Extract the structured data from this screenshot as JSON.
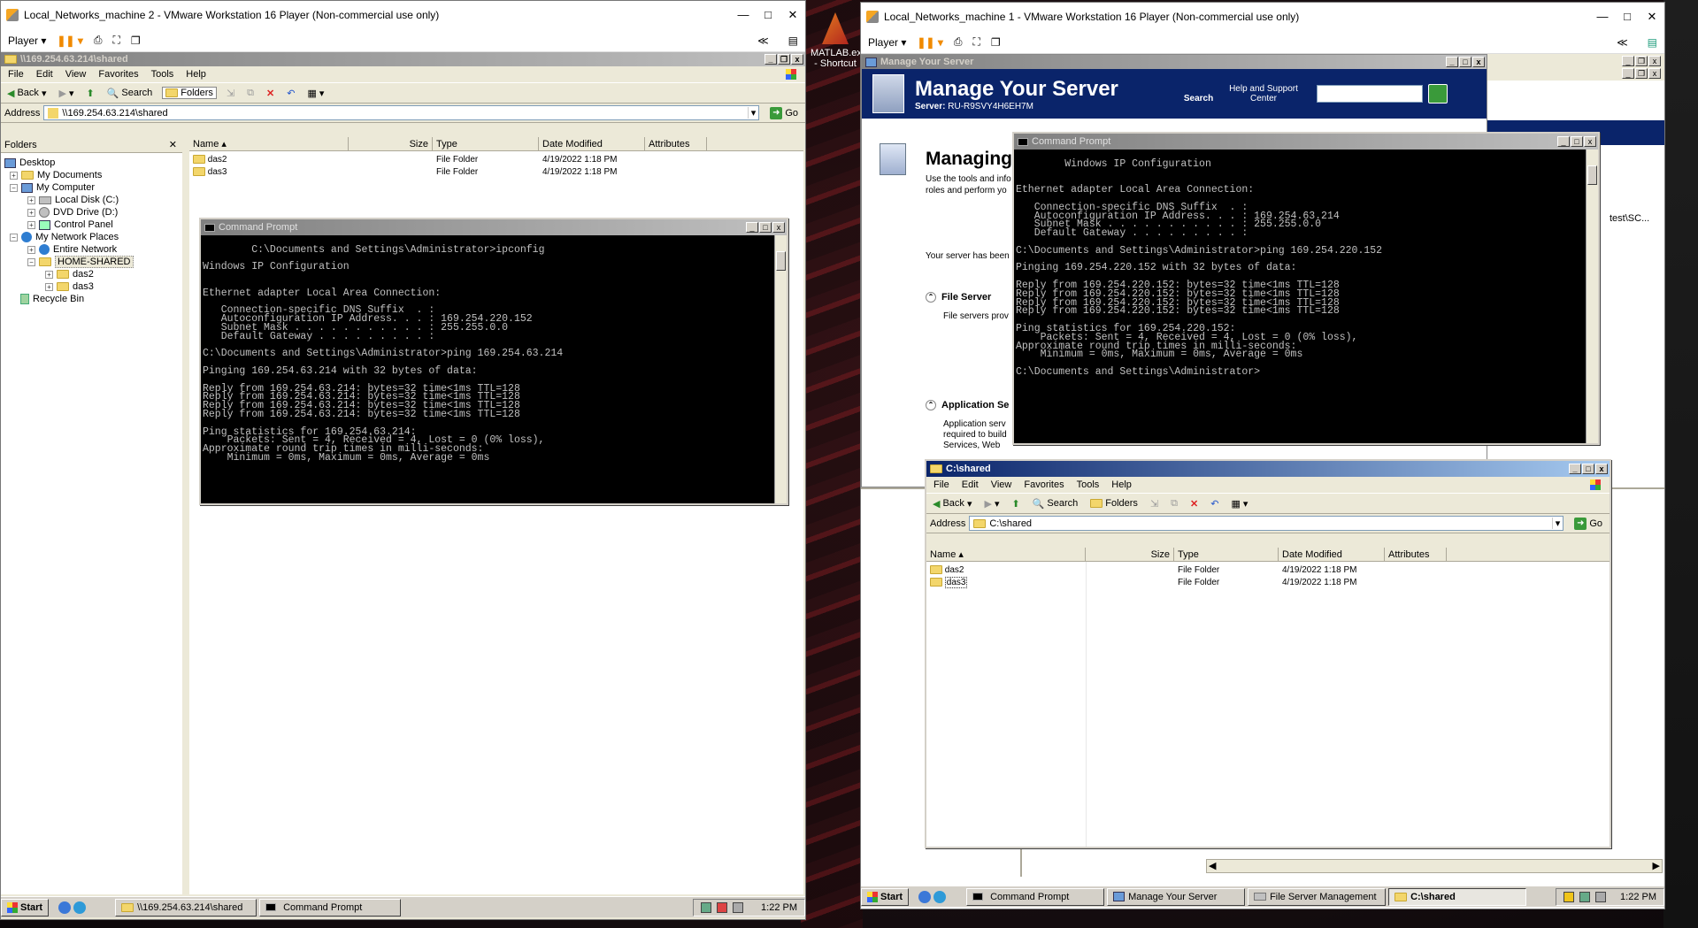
{
  "host": {
    "desktop_shortcut": {
      "label": "MATLAB.exe - Shortcut"
    }
  },
  "vm2": {
    "title": "Local_Networks_machine 2 - VMware Workstation 16 Player (Non-commercial use only)",
    "player_label": "Player",
    "explorer": {
      "title": "\\\\169.254.63.214\\shared",
      "menu": [
        "File",
        "Edit",
        "View",
        "Favorites",
        "Tools",
        "Help"
      ],
      "toolbar": {
        "back": "Back",
        "search": "Search",
        "folders": "Folders"
      },
      "address_label": "Address",
      "address_value": "\\\\169.254.63.214\\shared",
      "go": "Go",
      "folders_pane": {
        "header": "Folders",
        "items": [
          "Desktop",
          "My Documents",
          "My Computer",
          "Local Disk (C:)",
          "DVD Drive (D:)",
          "Control Panel",
          "My Network Places",
          "Entire Network",
          "HOME-SHARED",
          "das2",
          "das3",
          "Recycle Bin"
        ]
      },
      "columns": [
        "Name",
        "Size",
        "Type",
        "Date Modified",
        "Attributes"
      ],
      "rows": [
        {
          "name": "das2",
          "size": "",
          "type": "File Folder",
          "modified": "4/19/2022 1:18 PM"
        },
        {
          "name": "das3",
          "size": "",
          "type": "File Folder",
          "modified": "4/19/2022 1:18 PM"
        }
      ]
    },
    "cmd": {
      "title": "Command Prompt",
      "text": "C:\\Documents and Settings\\Administrator>ipconfig\n\nWindows IP Configuration\n\n\nEthernet adapter Local Area Connection:\n\n   Connection-specific DNS Suffix  . :\n   Autoconfiguration IP Address. . . : 169.254.220.152\n   Subnet Mask . . . . . . . . . . . : 255.255.0.0\n   Default Gateway . . . . . . . . . :\n\nC:\\Documents and Settings\\Administrator>ping 169.254.63.214\n\nPinging 169.254.63.214 with 32 bytes of data:\n\nReply from 169.254.63.214: bytes=32 time<1ms TTL=128\nReply from 169.254.63.214: bytes=32 time<1ms TTL=128\nReply from 169.254.63.214: bytes=32 time<1ms TTL=128\nReply from 169.254.63.214: bytes=32 time<1ms TTL=128\n\nPing statistics for 169.254.63.214:\n    Packets: Sent = 4, Received = 4, Lost = 0 (0% loss),\nApproximate round trip times in milli-seconds:\n    Minimum = 0ms, Maximum = 0ms, Average = 0ms"
    },
    "taskbar": {
      "start": "Start",
      "tasks": [
        "\\\\169.254.63.214\\shared",
        "Command Prompt"
      ],
      "clock": "1:22 PM"
    }
  },
  "vm1": {
    "title": "Local_Networks_machine 1 - VMware Workstation 16 Player (Non-commercial use only)",
    "player_label": "Player",
    "manage_server": {
      "window_title": "Manage Your Server",
      "heading": "Manage Your Server",
      "server_label": "Server:",
      "server_name": "RU-R9SVY4H6EH7M",
      "search_label": "Search",
      "search_sub": "Help and Support Center",
      "managing_heading": "Managing",
      "intro_text": "Use the tools and info roles and perform yo",
      "status_text": "Your server has been",
      "file_server": {
        "title": "File Server",
        "desc": "File servers prov"
      },
      "app_server": {
        "title": "Application Se",
        "desc": "Application serv required to build Services, Web applications, and distributed"
      }
    },
    "side_text": "test\\SC...",
    "cmd": {
      "title": "Command Prompt",
      "text": "Windows IP Configuration\n\n\nEthernet adapter Local Area Connection:\n\n   Connection-specific DNS Suffix  . :\n   Autoconfiguration IP Address. . . : 169.254.63.214\n   Subnet Mask . . . . . . . . . . . : 255.255.0.0\n   Default Gateway . . . . . . . . . :\n\nC:\\Documents and Settings\\Administrator>ping 169.254.220.152\n\nPinging 169.254.220.152 with 32 bytes of data:\n\nReply from 169.254.220.152: bytes=32 time<1ms TTL=128\nReply from 169.254.220.152: bytes=32 time<1ms TTL=128\nReply from 169.254.220.152: bytes=32 time<1ms TTL=128\nReply from 169.254.220.152: bytes=32 time<1ms TTL=128\n\nPing statistics for 169.254.220.152:\n    Packets: Sent = 4, Received = 4, Lost = 0 (0% loss),\nApproximate round trip times in milli-seconds:\n    Minimum = 0ms, Maximum = 0ms, Average = 0ms\n\nC:\\Documents and Settings\\Administrator>"
    },
    "explorer": {
      "title": "C:\\shared",
      "menu": [
        "File",
        "Edit",
        "View",
        "Favorites",
        "Tools",
        "Help"
      ],
      "toolbar": {
        "back": "Back",
        "search": "Search",
        "folders": "Folders"
      },
      "address_label": "Address",
      "address_value": "C:\\shared",
      "go": "Go",
      "columns": [
        "Name",
        "Size",
        "Type",
        "Date Modified",
        "Attributes"
      ],
      "rows": [
        {
          "name": "das2",
          "size": "",
          "type": "File Folder",
          "modified": "4/19/2022 1:18 PM"
        },
        {
          "name": "das3",
          "size": "",
          "type": "File Folder",
          "modified": "4/19/2022 1:18 PM"
        }
      ]
    },
    "taskbar": {
      "start": "Start",
      "tasks": [
        "Command Prompt",
        "Manage Your Server",
        "File Server Management",
        "C:\\shared"
      ],
      "clock": "1:22 PM"
    }
  }
}
